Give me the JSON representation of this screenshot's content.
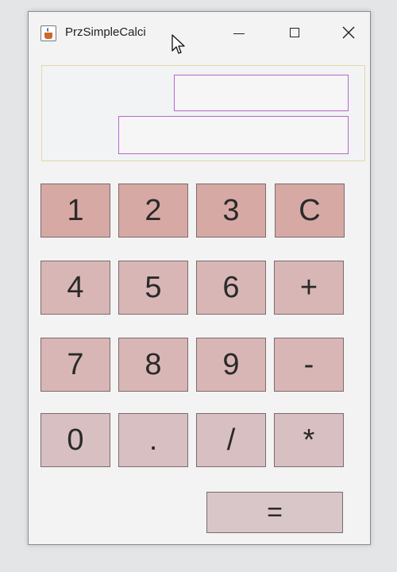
{
  "window": {
    "title": "PrzSimpleCalci",
    "icon": "java-cup-icon",
    "controls": [
      "minimize-icon",
      "maximize-icon",
      "close-icon"
    ]
  },
  "display": {
    "expression": "",
    "result": ""
  },
  "keys": {
    "k1": "1",
    "k2": "2",
    "k3": "3",
    "clear": "C",
    "k4": "4",
    "k5": "5",
    "k6": "6",
    "plus": "+",
    "k7": "7",
    "k8": "8",
    "k9": "9",
    "minus": "-",
    "k0": "0",
    "dot": ".",
    "divide": "/",
    "multiply": "*",
    "equals": "="
  },
  "colors": {
    "key_row1": "#d7a9a5",
    "key": "#d9b6b6",
    "field_border": "#b766cf"
  }
}
